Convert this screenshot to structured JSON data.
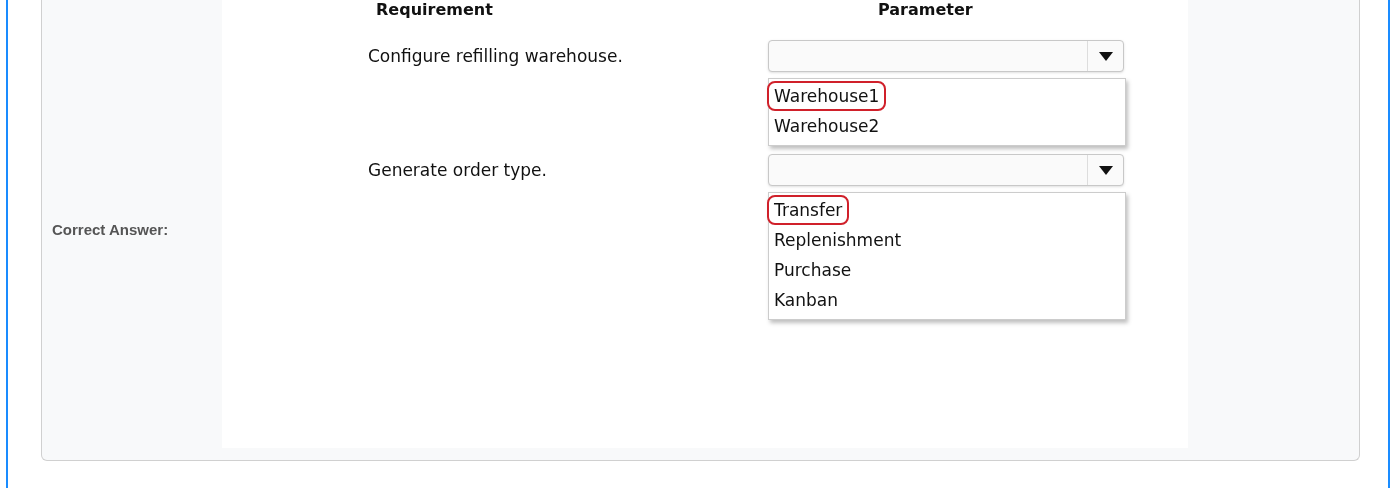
{
  "answer_label": "Correct Answer:",
  "headers": [
    "Requirement",
    "Parameter"
  ],
  "requirements": [
    {
      "label": "Configure refilling warehouse.",
      "options": [
        {
          "text": "Warehouse1",
          "selected": true
        },
        {
          "text": "Warehouse2",
          "selected": false
        }
      ]
    },
    {
      "label": "Generate order type.",
      "options": [
        {
          "text": "Transfer",
          "selected": true
        },
        {
          "text": "Replenishment",
          "selected": false
        },
        {
          "text": "Purchase",
          "selected": false
        },
        {
          "text": "Kanban",
          "selected": false
        }
      ]
    }
  ]
}
